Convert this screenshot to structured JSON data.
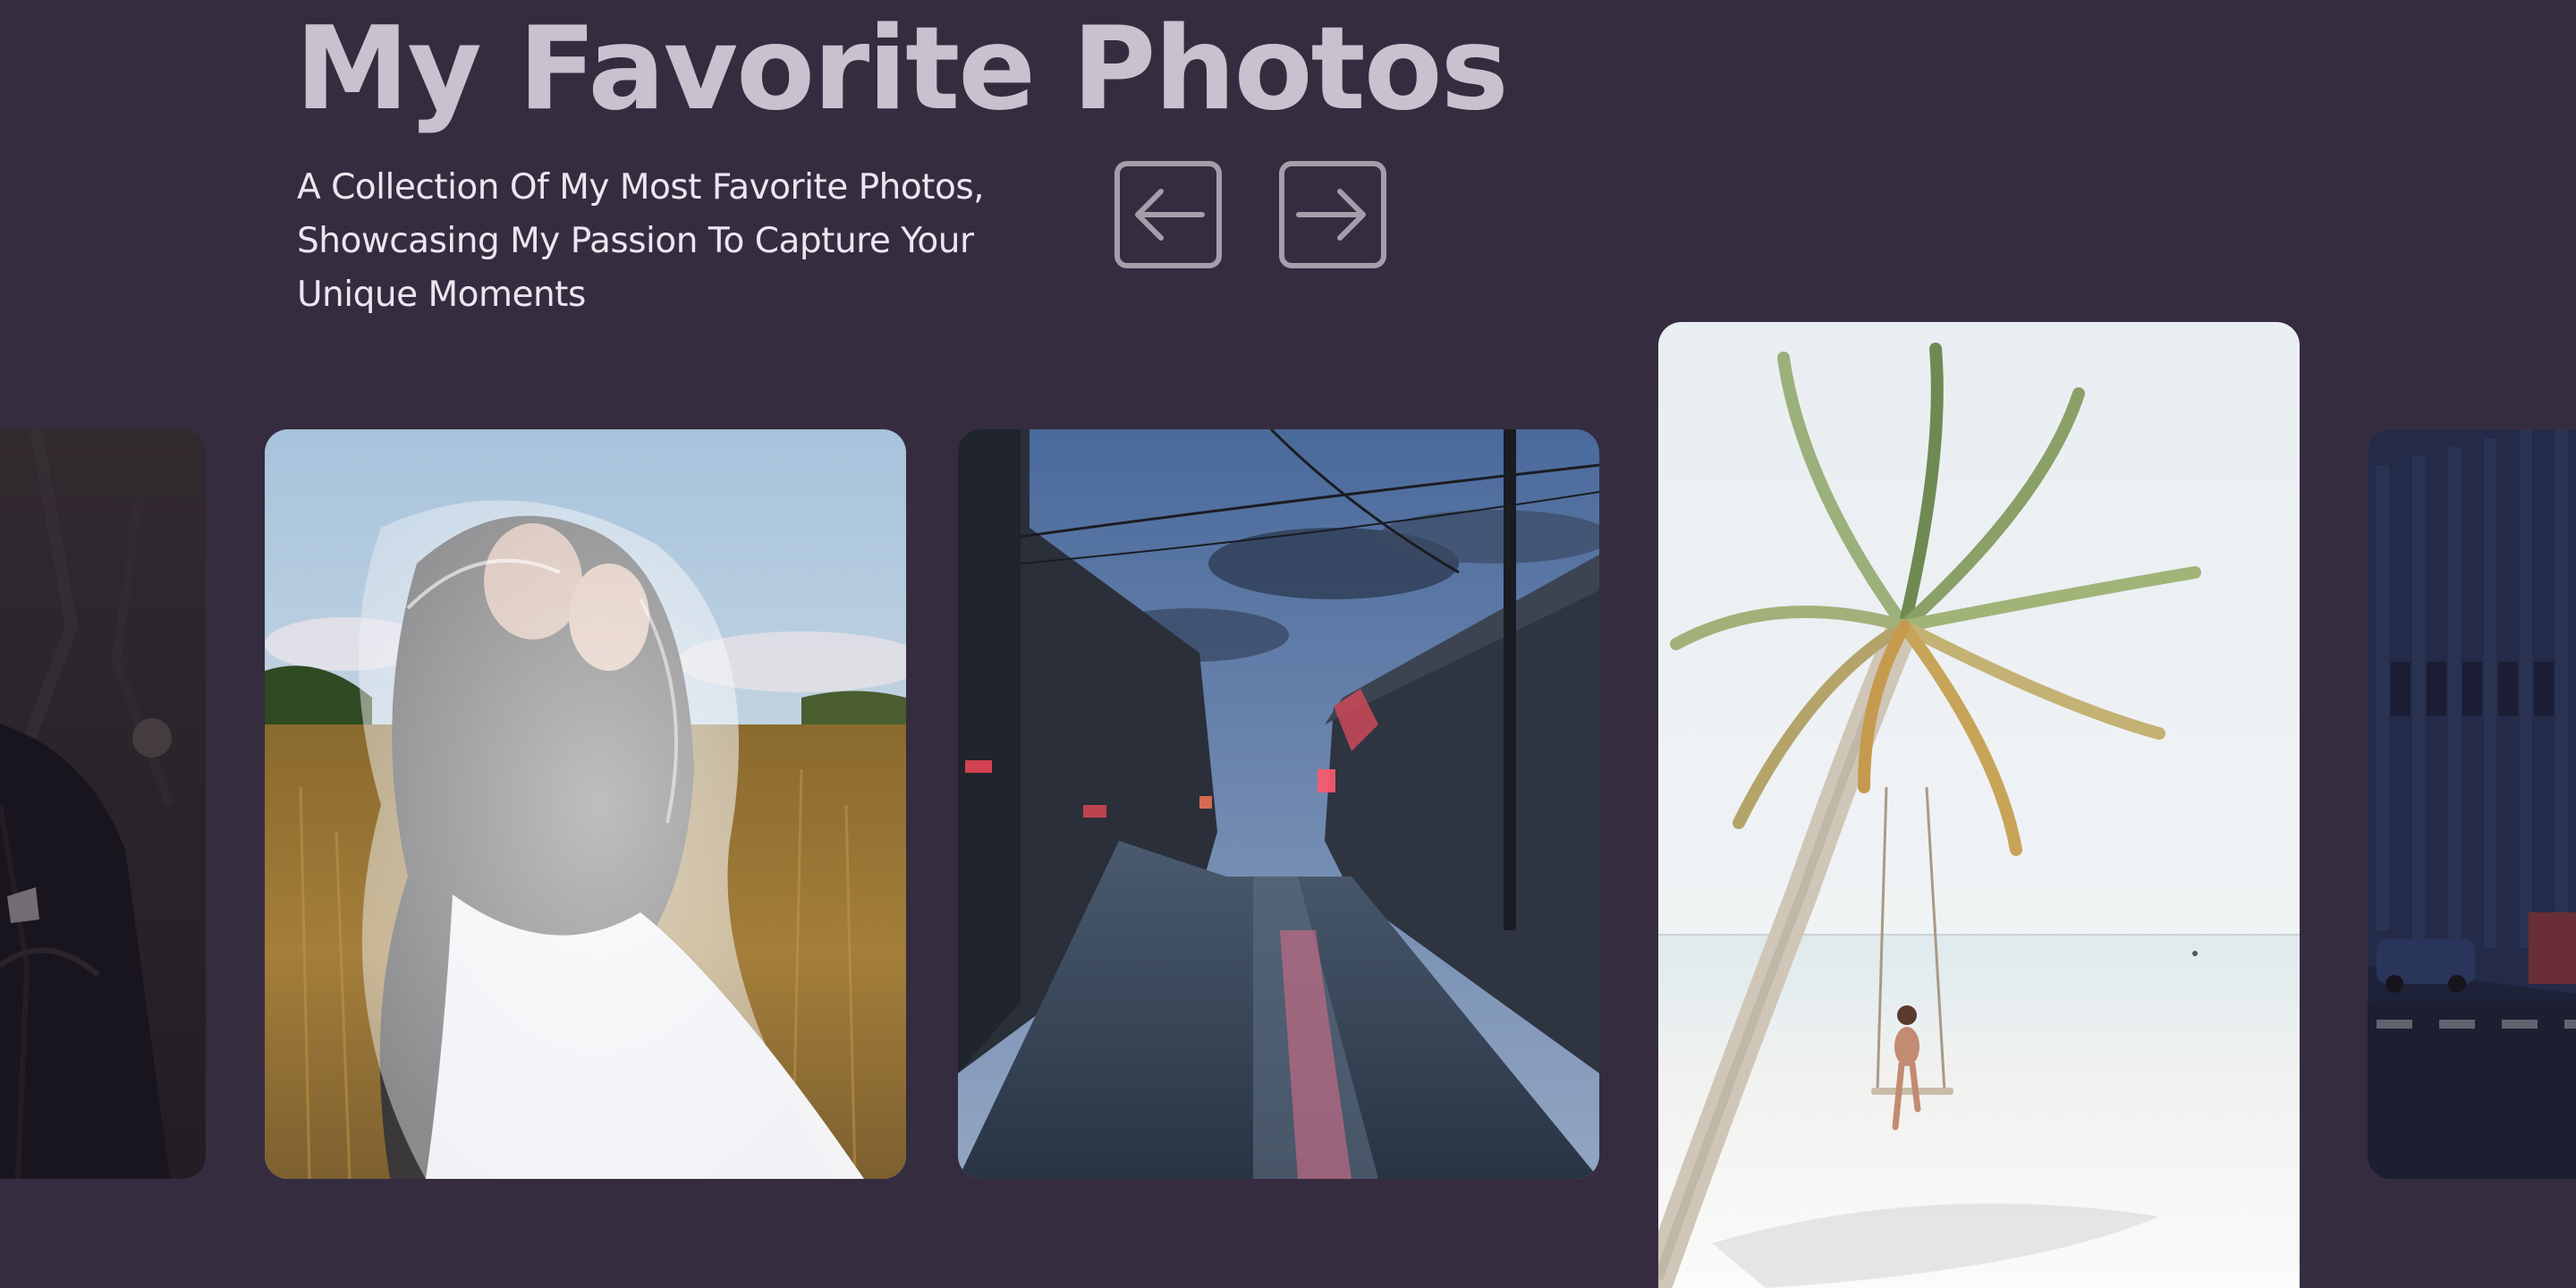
{
  "header": {
    "title": "My Favorite Photos",
    "subtitle": "A Collection Of My Most Favorite Photos, Showcasing My Passion To Capture Your Unique Moments"
  },
  "navigation": {
    "prev_icon": "arrow-left-icon",
    "next_icon": "arrow-right-icon"
  },
  "gallery": {
    "photos": [
      {
        "subject": "man in suit (partially visible)",
        "state": "dimmed"
      },
      {
        "subject": "bride and groom under veil in wheat field"
      },
      {
        "subject": "wet cobblestone alley at dusk"
      },
      {
        "subject": "woman on swing under palm tree at beach",
        "state": "active"
      },
      {
        "subject": "city street with buildings (partially visible)",
        "state": "dimmed"
      }
    ]
  },
  "colors": {
    "background": "#352d3f",
    "title": "#c8c2cf",
    "subtitle": "#ebe6ef",
    "button_border": "#a49eaa"
  }
}
